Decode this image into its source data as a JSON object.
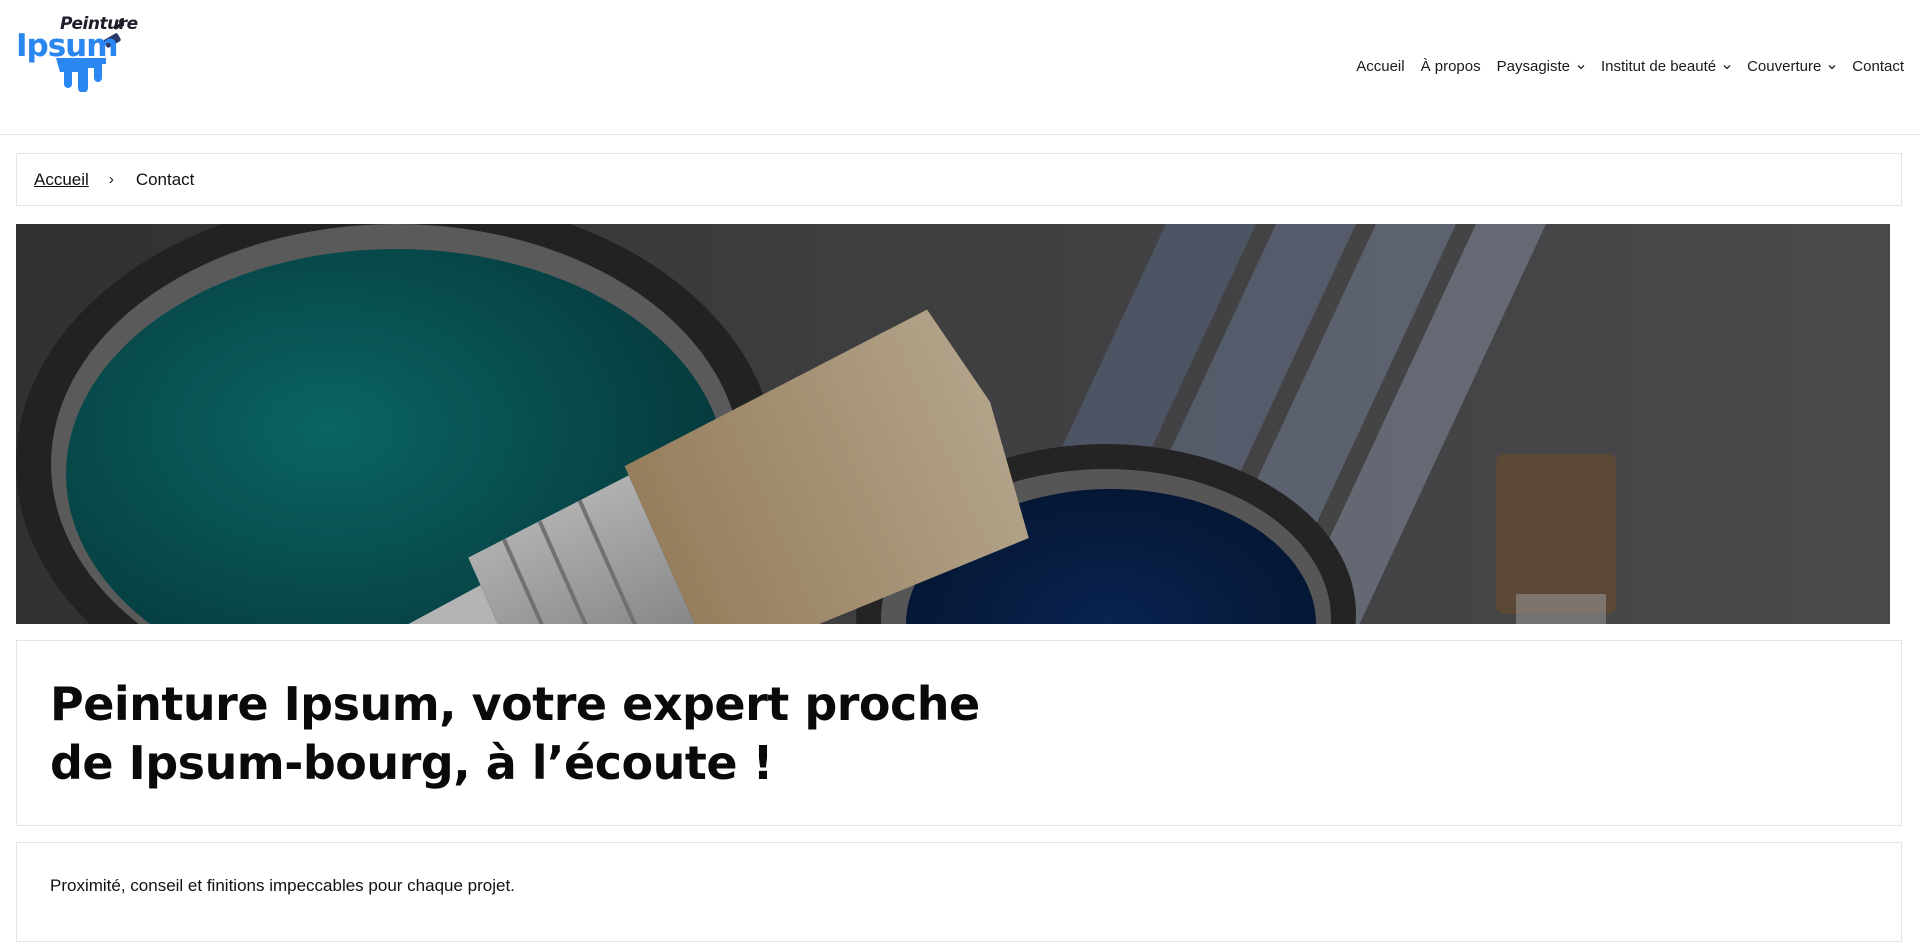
{
  "brand": {
    "top": "Peinture",
    "main": "Ipsum"
  },
  "nav": [
    {
      "label": "Accueil",
      "dropdown": false
    },
    {
      "label": "À propos",
      "dropdown": false
    },
    {
      "label": "Paysagiste",
      "dropdown": true
    },
    {
      "label": "Institut de beauté",
      "dropdown": true
    },
    {
      "label": "Couverture",
      "dropdown": true
    },
    {
      "label": "Contact",
      "dropdown": false
    }
  ],
  "breadcrumb": {
    "home": "Accueil",
    "separator": "›",
    "current": "Contact"
  },
  "hero": {
    "image": "paint-brush-and-paint-cans-photo"
  },
  "page": {
    "title": "Peinture Ipsum, votre expert proche de Ipsum-bourg, à l’écoute !",
    "intro": "Proximité, conseil et finitions impeccables pour chaque projet."
  },
  "colors": {
    "brand_blue": "#2a86f0",
    "text": "#111111",
    "border": "#e3e3e3"
  }
}
